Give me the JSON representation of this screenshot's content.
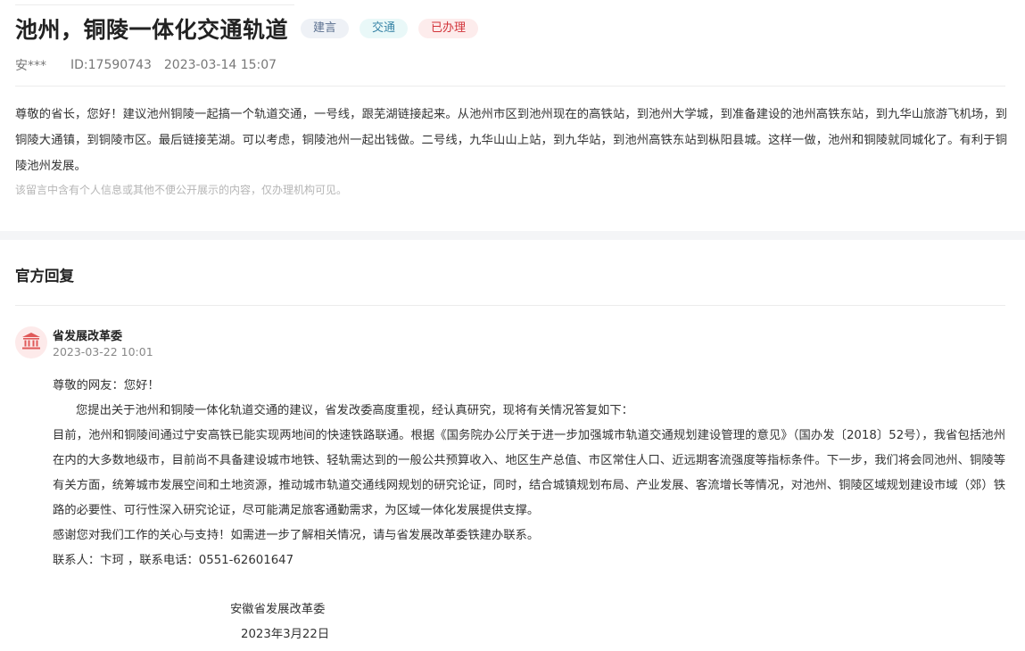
{
  "message": {
    "title": "池州，铜陵一体化交通轨道",
    "tags": [
      "建言",
      "交通",
      "已办理"
    ],
    "author": "安***",
    "id_text": "ID:17590743",
    "datetime": "2023-03-14 15:07",
    "content": "尊敬的省长，您好！建议池州铜陵一起搞一个轨道交通，一号线，跟芜湖链接起来。从池州市区到池州现在的高铁站，到池州大学城，到准备建设的池州高铁东站，到九华山旅游飞机场，到铜陵大通镇，到铜陵市区。最后链接芜湖。可以考虑，铜陵池州一起出钱做。二号线，九华山山上站，到九华站，到池州高铁东站到枞阳县城。这样一做，池州和铜陵就同城化了。有利于铜陵池州发展。",
    "privacy_note": "该留言中含有个人信息或其他不便公开展示的内容，仅办理机构可见。"
  },
  "reply_section": {
    "title": "官方回复",
    "org_icon": "government-building-icon",
    "org_name": "省发展改革委",
    "reply_time": "2023-03-22 10:01",
    "greeting": "尊敬的网友：您好！",
    "intro": "您提出关于池州和铜陵一体化轨道交通的建议，省发改委高度重视，经认真研究，现将有关情况答复如下：",
    "body": "目前，池州和铜陵间通过宁安高铁已能实现两地间的快速铁路联通。根据《国务院办公厅关于进一步加强城市轨道交通规划建设管理的意见》（国办发〔2018〕52号），我省包括池州在内的大多数地级市，目前尚不具备建设城市地铁、轻轨需达到的一般公共预算收入、地区生产总值、市区常住人口、近远期客流强度等指标条件。下一步，我们将会同池州、铜陵等有关方面，统筹城市发展空间和土地资源，推动城市轨道交通线网规划的研究论证，同时，结合城镇规划布局、产业发展、客流增长等情况，对池州、铜陵区域规划建设市域（郊）铁路的必要性、可行性深入研究论证，尽可能满足旅客通勤需求，为区域一体化发展提供支撑。",
    "thanks": "感谢您对我们工作的关心与支持！如需进一步了解相关情况，请与省发展改革委铁建办联系。",
    "contact": "联系人：卞珂 ，联系电话：0551-62601647",
    "signature_org": "安徽省发展改革委",
    "signature_date": "2023年3月22日"
  },
  "colors": {
    "tag_gray_bg": "#eef1f6",
    "tag_teal_bg": "#e9f8f8",
    "tag_red_bg": "#fdecec",
    "tag_red_text": "#d2343a",
    "icon_red": "#e05a5a"
  }
}
